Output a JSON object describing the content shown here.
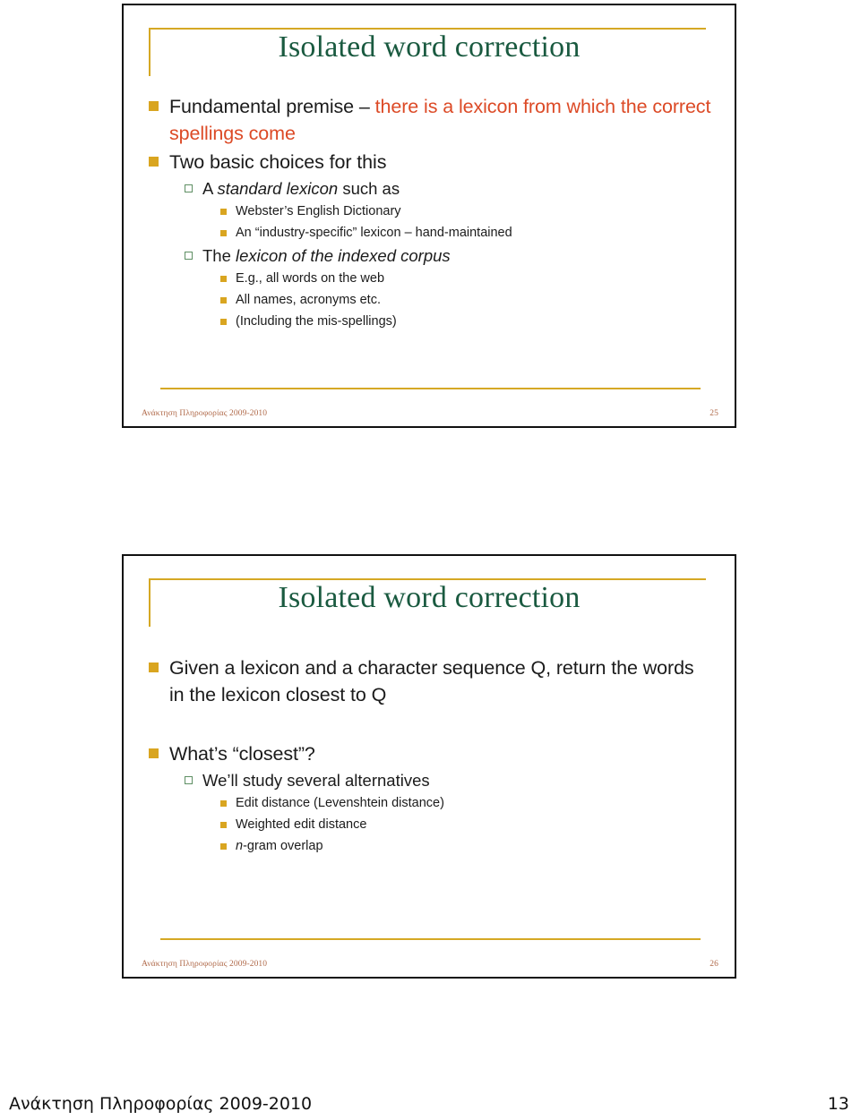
{
  "document": {
    "page_footer": {
      "course": "Ανάκτηση Πληροφορίας 2009-2010",
      "page_number": "13"
    }
  },
  "colors": {
    "title_green": "#1A5A40",
    "accent_gold": "#D5A824",
    "bullet_gold": "#D9A520",
    "sub_bullet_green": "#5E8F63",
    "highlight_red": "#DC4A26",
    "footer_text": "#B06A4A",
    "frame_black": "#111111"
  },
  "slides": [
    {
      "title": "Isolated word correction",
      "bullets": [
        {
          "level": 1,
          "parts": [
            {
              "text": "Fundamental premise – ",
              "style": "plain"
            },
            {
              "text": "there is a lexicon from which the correct spellings come",
              "style": "red"
            }
          ]
        },
        {
          "level": 1,
          "parts": [
            {
              "text": "Two basic choices for this",
              "style": "plain"
            }
          ]
        },
        {
          "level": 2,
          "parts": [
            {
              "text": "A ",
              "style": "plain"
            },
            {
              "text": "standard lexicon",
              "style": "italic"
            },
            {
              "text": " such as",
              "style": "plain"
            }
          ]
        },
        {
          "level": 3,
          "parts": [
            {
              "text": "Webster’s English Dictionary",
              "style": "plain"
            }
          ]
        },
        {
          "level": 3,
          "parts": [
            {
              "text": "An “industry-specific” lexicon – hand-maintained",
              "style": "plain"
            }
          ]
        },
        {
          "level": 2,
          "parts": [
            {
              "text": "The ",
              "style": "plain"
            },
            {
              "text": "lexicon of the indexed corpus",
              "style": "italic"
            }
          ]
        },
        {
          "level": 3,
          "parts": [
            {
              "text": "E.g., all words on the web",
              "style": "plain"
            }
          ]
        },
        {
          "level": 3,
          "parts": [
            {
              "text": "All names, acronyms etc.",
              "style": "plain"
            }
          ]
        },
        {
          "level": 3,
          "parts": [
            {
              "text": "(Including the mis-spellings)",
              "style": "plain"
            }
          ]
        }
      ],
      "footer": {
        "course": "Ανάκτηση Πληροφορίας 2009-2010",
        "number": "25"
      }
    },
    {
      "title": "Isolated word correction",
      "bullets": [
        {
          "level": 1,
          "parts": [
            {
              "text": "Given a lexicon and a character sequence Q, return the words in the lexicon closest to Q",
              "style": "plain"
            }
          ]
        },
        {
          "level": 1,
          "spacer_before": true,
          "parts": [
            {
              "text": "What’s “closest”?",
              "style": "plain"
            }
          ]
        },
        {
          "level": 2,
          "parts": [
            {
              "text": "We’ll study several alternatives",
              "style": "plain"
            }
          ]
        },
        {
          "level": 3,
          "parts": [
            {
              "text": "Edit distance (Levenshtein distance)",
              "style": "plain"
            }
          ]
        },
        {
          "level": 3,
          "parts": [
            {
              "text": "Weighted edit distance",
              "style": "plain"
            }
          ]
        },
        {
          "level": 3,
          "parts": [
            {
              "text": "n",
              "style": "italic"
            },
            {
              "text": "-gram overlap",
              "style": "plain"
            }
          ]
        }
      ],
      "footer": {
        "course": "Ανάκτηση Πληροφορίας 2009-2010",
        "number": "26"
      }
    }
  ]
}
